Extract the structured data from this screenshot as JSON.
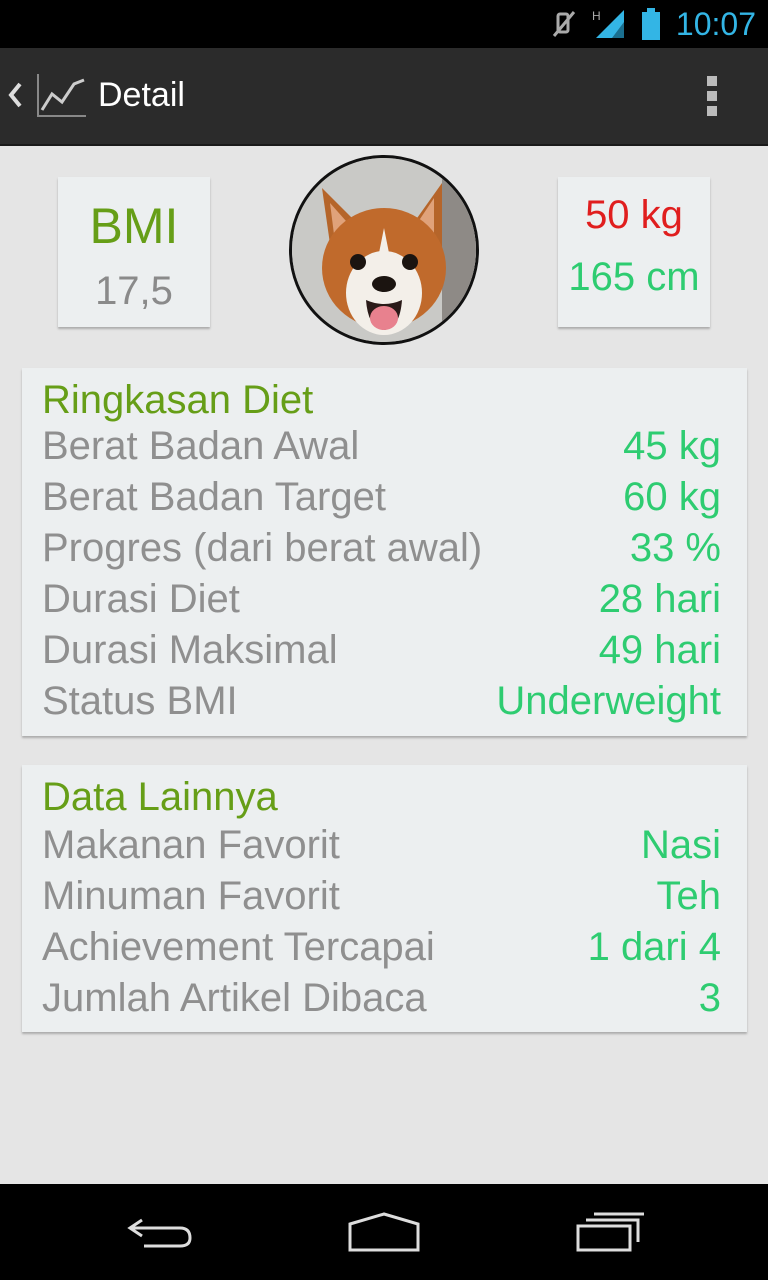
{
  "status_bar": {
    "time": "10:07",
    "icons": [
      "mute-icon",
      "signal-h-icon",
      "battery-icon"
    ]
  },
  "action_bar": {
    "up_icon": "chevron-left-icon",
    "app_icon": "chart-line-icon",
    "title": "Detail",
    "overflow_icon": "overflow-menu-icon"
  },
  "summary": {
    "bmi_label": "BMI",
    "bmi_value": "17,5",
    "weight": "50 kg",
    "height": "165 cm",
    "avatar": "puppy-photo"
  },
  "diet_summary": {
    "title": "Ringkasan Diet",
    "rows": [
      {
        "label": "Berat Badan Awal",
        "value": "45 kg"
      },
      {
        "label": "Berat Badan Target",
        "value": "60 kg"
      },
      {
        "label": "Progres (dari berat awal)",
        "value": "33 %"
      },
      {
        "label": "Durasi Diet",
        "value": "28 hari"
      },
      {
        "label": "Durasi Maksimal",
        "value": "49 hari"
      },
      {
        "label": "Status BMI",
        "value": "Underweight"
      }
    ]
  },
  "other_data": {
    "title": "Data Lainnya",
    "rows": [
      {
        "label": "Makanan Favorit",
        "value": "Nasi"
      },
      {
        "label": "Minuman Favorit",
        "value": "Teh"
      },
      {
        "label": "Achievement Tercapai",
        "value": "1 dari 4"
      },
      {
        "label": "Jumlah Artikel Dibaca",
        "value": "3"
      }
    ]
  },
  "nav_bar": {
    "buttons": [
      "back-icon",
      "home-icon",
      "recent-apps-icon"
    ]
  },
  "colors": {
    "accent_green": "#669e17",
    "value_green": "#2ecc71",
    "weight_red": "#e01e1e",
    "status_blue": "#33b5e5"
  }
}
